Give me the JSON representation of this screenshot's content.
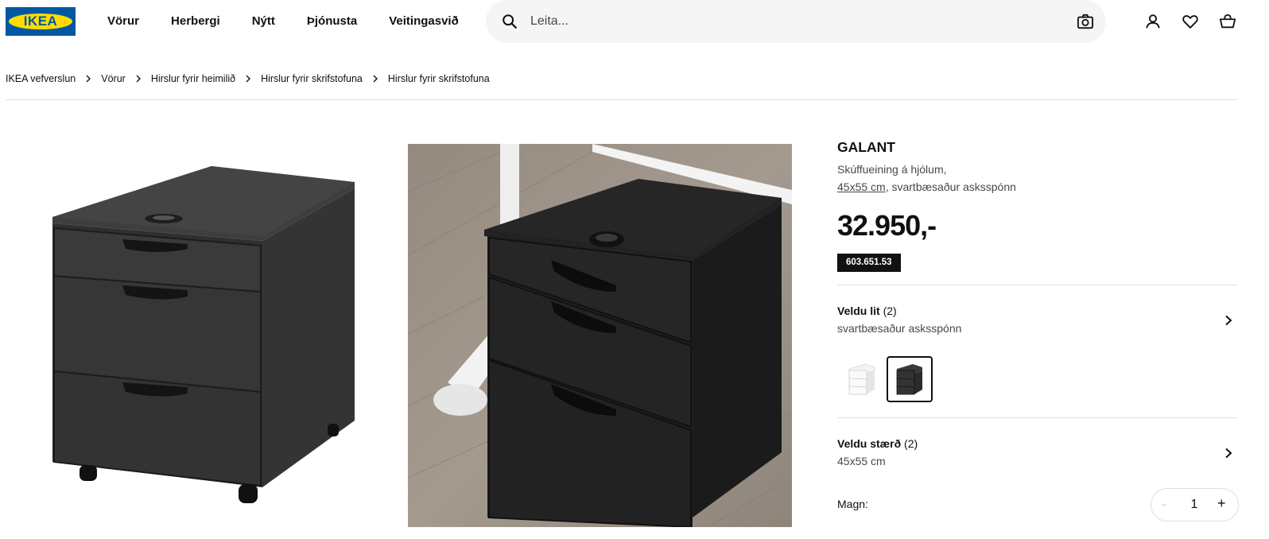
{
  "brand": {
    "logo_text": "IKEA",
    "blue": "#0058a3",
    "yellow": "#ffdb00"
  },
  "nav": [
    {
      "label": "Vörur"
    },
    {
      "label": "Herbergi"
    },
    {
      "label": "Nýtt"
    },
    {
      "label": "Þjónusta"
    },
    {
      "label": "Veitingasvið"
    }
  ],
  "search": {
    "placeholder": "Leita...",
    "icon": "search-icon",
    "camera_icon": "camera-icon"
  },
  "header_icons": [
    "user-icon",
    "heart-icon",
    "cart-icon"
  ],
  "breadcrumb": [
    {
      "label": "IKEA vefverslun"
    },
    {
      "label": "Vörur"
    },
    {
      "label": "Hirslur fyrir heimilið"
    },
    {
      "label": "Hirslur fyrir skrifstofuna"
    },
    {
      "label": "Hirslur fyrir skrifstofuna"
    }
  ],
  "product": {
    "name": "GALANT",
    "description_line1": "Skúffueining á hjólum,",
    "size_link": "45x55 cm",
    "description_rest": ", svartbæsaður asksspónn",
    "price": "32.950,-",
    "article_number": "603.651.53"
  },
  "color_option": {
    "title": "Veldu lit",
    "count": "(2)",
    "value": "svartbæsaður asksspónn",
    "swatches": [
      "white-variant",
      "black-variant"
    ],
    "selected_index": 1
  },
  "size_option": {
    "title": "Veldu stærð",
    "count": "(2)",
    "value": "45x55 cm"
  },
  "quantity": {
    "label": "Magn:",
    "minus": "-",
    "value": "1",
    "plus": "+"
  }
}
